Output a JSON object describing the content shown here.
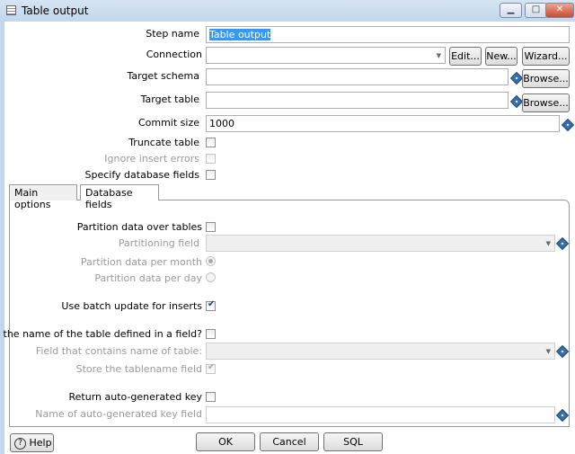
{
  "window": {
    "title": "Table output",
    "minimize": "▁",
    "maximize": "□",
    "close": "✕"
  },
  "form": {
    "step_name": {
      "label": "Step name",
      "value": "Table output"
    },
    "connection": {
      "label": "Connection",
      "value": "",
      "edit": "Edit...",
      "new": "New...",
      "wizard": "Wizard..."
    },
    "target_schema": {
      "label": "Target schema",
      "value": "",
      "browse": "Browse..."
    },
    "target_table": {
      "label": "Target table",
      "value": "",
      "browse": "Browse..."
    },
    "commit_size": {
      "label": "Commit size",
      "value": "1000"
    },
    "truncate_table": {
      "label": "Truncate table",
      "checked": false
    },
    "ignore_insert_errors": {
      "label": "Ignore insert errors",
      "checked": false,
      "disabled": true
    },
    "specify_db_fields": {
      "label": "Specify database fields",
      "checked": false
    }
  },
  "tabs": [
    {
      "label": "Main options",
      "active": true
    },
    {
      "label": "Database fields",
      "active": false
    }
  ],
  "main_options": {
    "partition_over_tables": {
      "label": "Partition data over tables",
      "checked": false
    },
    "partitioning_field": {
      "label": "Partitioning field",
      "value": ""
    },
    "per_month": {
      "label": "Partition data per month",
      "selected": true
    },
    "per_day": {
      "label": "Partition data per day",
      "selected": false
    },
    "batch_update": {
      "label": "Use batch update for inserts",
      "checked": true
    },
    "name_in_field": {
      "label": "Is the name of the table defined in a field?",
      "checked": false
    },
    "field_with_table_name": {
      "label": "Field that contains name of table:",
      "value": ""
    },
    "store_tablename": {
      "label": "Store the tablename field",
      "checked": true
    },
    "return_key": {
      "label": "Return auto-generated key",
      "checked": false
    },
    "key_field_name": {
      "label": "Name of auto-generated key field",
      "value": ""
    }
  },
  "footer": {
    "help": "Help",
    "ok": "OK",
    "cancel": "Cancel",
    "sql": "SQL"
  },
  "icons": {
    "variable": "dollar-diamond-icon",
    "help": "question-circle-icon"
  },
  "colors": {
    "selection": "#3399ff",
    "frame": "#c3d6ec",
    "variable_icon": "#3a6fa8"
  }
}
